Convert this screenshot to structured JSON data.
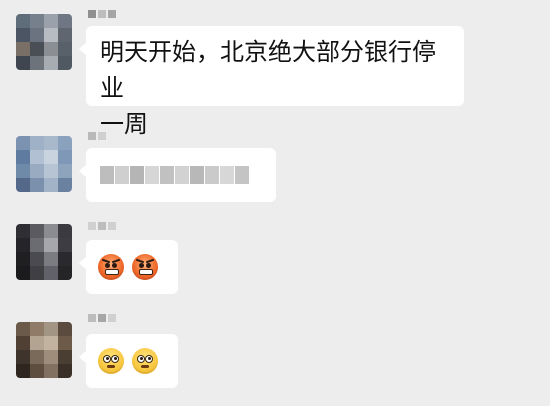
{
  "chat": {
    "messages": [
      {
        "id": "m1",
        "type": "text",
        "text": "明天开始，北京绝大部分银行停业\n一周"
      },
      {
        "id": "m2",
        "type": "blurred-text"
      },
      {
        "id": "m3",
        "type": "emoji",
        "emoji": [
          "angry-face",
          "angry-face"
        ]
      },
      {
        "id": "m4",
        "type": "emoji",
        "emoji": [
          "rolling-eyes-face",
          "rolling-eyes-face"
        ]
      }
    ]
  },
  "colors": {
    "background": "#ededed",
    "bubble": "#ffffff",
    "text": "#111111",
    "angry_emoji": "#ef6a2a",
    "rolleyes_emoji": "#f7c640"
  }
}
